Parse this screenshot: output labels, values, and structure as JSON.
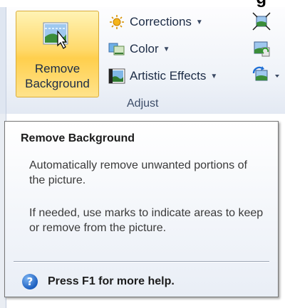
{
  "top_crop_text": "g",
  "ribbon": {
    "remove_background_label": "Remove Background",
    "corrections_label": "Corrections",
    "color_label": "Color",
    "artistic_effects_label": "Artistic Effects",
    "group_label": "Adjust"
  },
  "tooltip": {
    "title": "Remove Background",
    "paragraph1": "Automatically remove unwanted portions of the picture.",
    "paragraph2": "If needed, use marks to indicate areas to keep or remove from the picture.",
    "help_text": "Press F1 for more help."
  },
  "icons": {
    "remove_background": "remove-background-icon",
    "corrections": "sun-icon",
    "color": "color-icon",
    "artistic_effects": "artistic-effects-icon",
    "help": "help-icon"
  },
  "colors": {
    "button_highlight": "#ffd96a",
    "help_icon": "#1d5fbf"
  }
}
